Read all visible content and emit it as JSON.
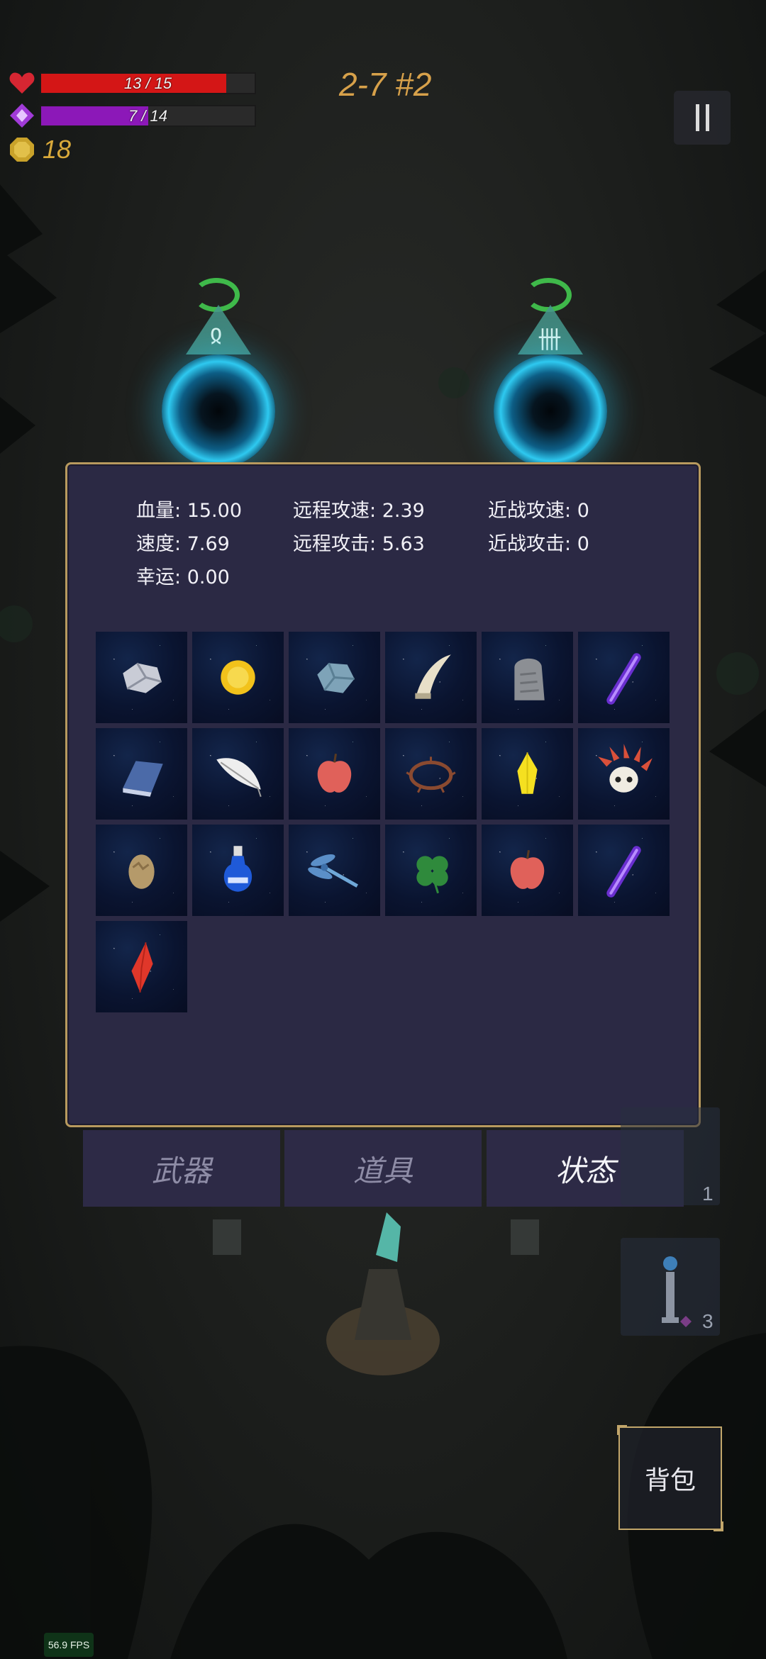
{
  "hud": {
    "hp_text": "13 / 15",
    "hp_fraction": 0.867,
    "mp_text": "7 / 14",
    "mp_fraction": 0.5,
    "gold": "18",
    "level": "2-7 #2",
    "colors": {
      "hp": "#d41616",
      "mp": "#8c18b8",
      "gold": "#d9a93a",
      "level": "#d7a14a"
    }
  },
  "portals": [
    {
      "glyph": "ჲ"
    },
    {
      "glyph": "卌"
    }
  ],
  "stats": {
    "hp_label": "血量:",
    "hp_value": "15.00",
    "ranged_speed_label": "远程攻速:",
    "ranged_speed_value": "2.39",
    "melee_speed_label": "近战攻速:",
    "melee_speed_value": "0",
    "speed_label": "速度:",
    "speed_value": "7.69",
    "ranged_attack_label": "远程攻击:",
    "ranged_attack_value": "5.63",
    "melee_attack_label": "近战攻击:",
    "melee_attack_value": "0",
    "luck_label": "幸运:",
    "luck_value": "0.00"
  },
  "items": [
    "silver-ore-icon",
    "gold-coin-icon",
    "blue-stone-icon",
    "fang-icon",
    "tombstone-icon",
    "purple-wand-icon",
    "blue-book-icon",
    "feather-icon",
    "red-apple-icon",
    "thorn-crown-icon",
    "yellow-crystal-icon",
    "feather-skull-icon",
    "egg-icon",
    "blue-potion-icon",
    "dragonfly-icon",
    "four-leaf-clover-icon",
    "red-apple-icon",
    "purple-wand-icon",
    "red-crystal-icon"
  ],
  "tabs": [
    {
      "label": "武器",
      "active": false
    },
    {
      "label": "道具",
      "active": false
    },
    {
      "label": "状态",
      "active": true
    }
  ],
  "side_cards": [
    {
      "count": "1"
    },
    {
      "count": "3"
    }
  ],
  "bag_label": "背包",
  "fps": "56.9 FPS"
}
